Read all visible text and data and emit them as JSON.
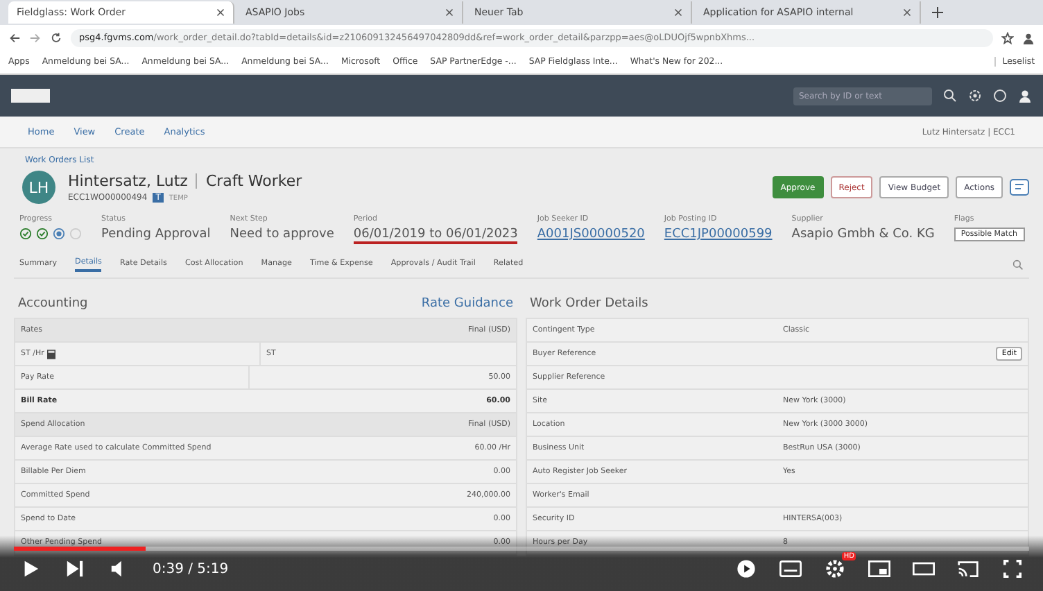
{
  "browser": {
    "tabs": [
      {
        "title": "Fieldglass: Work Order",
        "selected": true
      },
      {
        "title": "ASAPIO Jobs",
        "selected": false
      },
      {
        "title": "Neuer Tab",
        "selected": false
      },
      {
        "title": "Application for ASAPIO internal",
        "selected": false
      }
    ],
    "url_host": "psg4.fgvms.com",
    "url_path": "/work_order_detail.do?tabId=details&id=z210609132456497042809dd&ref=work_order_detail&parzpp=aes@oLDUOjf5wpnbXhms...",
    "bookmarks": [
      "Apps",
      "Anmeldung bei SA...",
      "Anmeldung bei SA...",
      "Anmeldung bei SA...",
      "Microsoft",
      "Office",
      "SAP PartnerEdge -...",
      "SAP Fieldglass Inte...",
      "What's New for 202..."
    ],
    "reading_list": "Leselist"
  },
  "app_header": {
    "search_placeholder": "Search by ID or text"
  },
  "nav": {
    "items": [
      "Home",
      "View",
      "Create",
      "Analytics"
    ],
    "user": "Lutz Hintersatz | ECC1"
  },
  "breadcrumb": "Work Orders List",
  "worker": {
    "initials": "LH",
    "name": "Hintersatz, Lutz",
    "role": "Craft Worker",
    "id": "ECC1WO00000494",
    "type_badge": "T",
    "type": "TEMP"
  },
  "actions": [
    "Approve",
    "Reject",
    "View Budget",
    "Actions"
  ],
  "summary": {
    "progress_label": "Progress",
    "progress": [
      {
        "kind": "done"
      },
      {
        "kind": "done"
      },
      {
        "kind": "current"
      },
      {
        "kind": "pending"
      }
    ],
    "fields": [
      {
        "label": "Status",
        "value": "Pending Approval",
        "kind": "text"
      },
      {
        "label": "Next Step",
        "value": "Need to approve",
        "kind": "text"
      },
      {
        "label": "Period",
        "value": "06/01/2019 to 06/01/2023",
        "kind": "underlined"
      },
      {
        "label": "Job Seeker ID",
        "value": "A001JS00000520",
        "kind": "link"
      },
      {
        "label": "Job Posting ID",
        "value": "ECC1JP00000599",
        "kind": "link"
      },
      {
        "label": "Supplier",
        "value": "Asapio Gmbh & Co. KG",
        "kind": "text"
      },
      {
        "label": "Flags",
        "value": "Possible Match",
        "kind": "tag"
      }
    ]
  },
  "tabs": [
    {
      "label": "Summary",
      "selected": false
    },
    {
      "label": "Details",
      "selected": true
    },
    {
      "label": "Rate Details",
      "selected": false
    },
    {
      "label": "Cost Allocation",
      "selected": false
    },
    {
      "label": "Manage",
      "selected": false
    },
    {
      "label": "Time & Expense",
      "selected": false
    },
    {
      "label": "Approvals / Audit Trail",
      "selected": false
    },
    {
      "label": "Related",
      "selected": false
    }
  ],
  "accounting": {
    "title": "Accounting",
    "link": "Rate Guidance",
    "rows": [
      {
        "kind": "header",
        "label": "Rates",
        "value": "Final (USD)"
      },
      {
        "kind": "calc",
        "label": "ST /Hr",
        "middle": "ST",
        "value": ""
      },
      {
        "kind": "split",
        "label": "Pay Rate",
        "middle": "",
        "value": "50.00"
      },
      {
        "kind": "bold",
        "label": "Bill Rate",
        "middle": "",
        "value": "60.00"
      },
      {
        "kind": "header",
        "label": "Spend Allocation",
        "value": "Final (USD)"
      },
      {
        "kind": "row",
        "label": "Average Rate used to calculate Committed Spend",
        "value": "60.00 /Hr"
      },
      {
        "kind": "row",
        "label": "Billable Per Diem",
        "value": "0.00"
      },
      {
        "kind": "row",
        "label": "Committed Spend",
        "value": "240,000.00"
      },
      {
        "kind": "row",
        "label": "Spend to Date",
        "value": "0.00"
      },
      {
        "kind": "row",
        "label": "Other Pending Spend",
        "value": "0.00"
      }
    ]
  },
  "details": {
    "title": "Work Order Details",
    "rows": [
      {
        "label": "Contingent Type",
        "value": "Classic"
      },
      {
        "label": "Buyer Reference",
        "value": "",
        "button": "Edit"
      },
      {
        "label": "Supplier Reference",
        "value": ""
      },
      {
        "label": "Site",
        "value": "New York (3000)"
      },
      {
        "label": "Location",
        "value": "New York (3000 3000)"
      },
      {
        "label": "Business Unit",
        "value": "BestRun USA (3000)"
      },
      {
        "label": "Auto Register Job Seeker",
        "value": "Yes"
      },
      {
        "label": "Worker's Email",
        "value": ""
      },
      {
        "label": "Security ID",
        "value": "HINTERSA(003)"
      },
      {
        "label": "Hours per Day",
        "value": "8"
      }
    ]
  },
  "player": {
    "level": 0.13,
    "time": "0:39 / 5:19",
    "quality": "HD"
  }
}
